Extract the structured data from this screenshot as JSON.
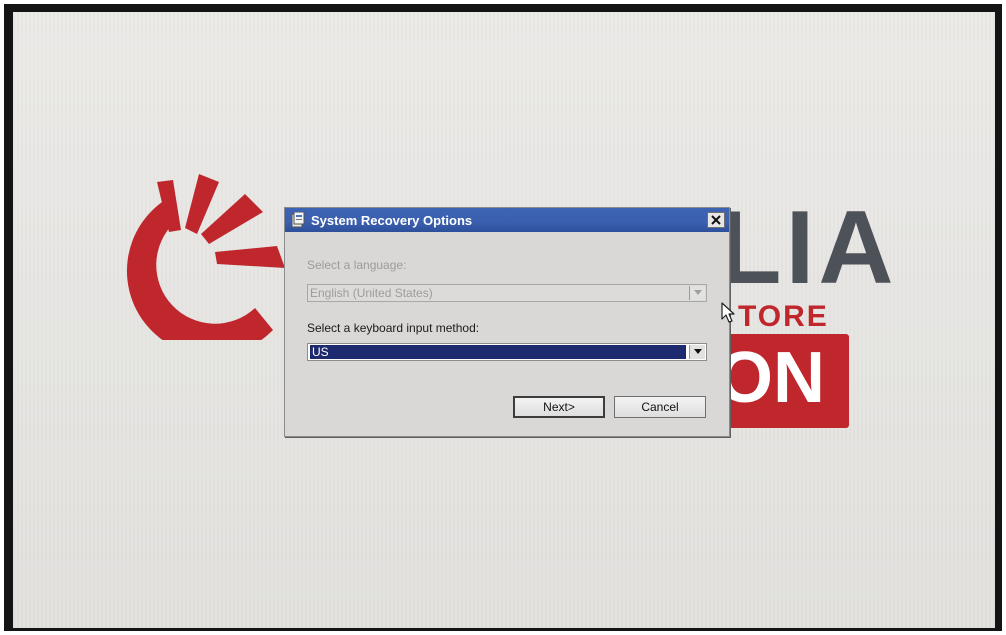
{
  "brand": {
    "name_fragment": "LIA",
    "subtitle_fragment": "TORE",
    "box_fragment": "ON",
    "colors": {
      "red": "#c0272d",
      "gray": "#4d5259"
    }
  },
  "dialog": {
    "title": "System Recovery Options",
    "icon": "recovery-app-icon",
    "close_icon": "close-icon",
    "language_label": "Select a language:",
    "language_value": "English (United States)",
    "language_disabled": true,
    "keyboard_label": "Select a keyboard input method:",
    "keyboard_value": "US",
    "next_label": "Next>",
    "cancel_label": "Cancel",
    "colors": {
      "titlebar": "#3b5fae",
      "selection": "#1e2a6e",
      "dialog_bg": "#d9d8d6"
    }
  }
}
